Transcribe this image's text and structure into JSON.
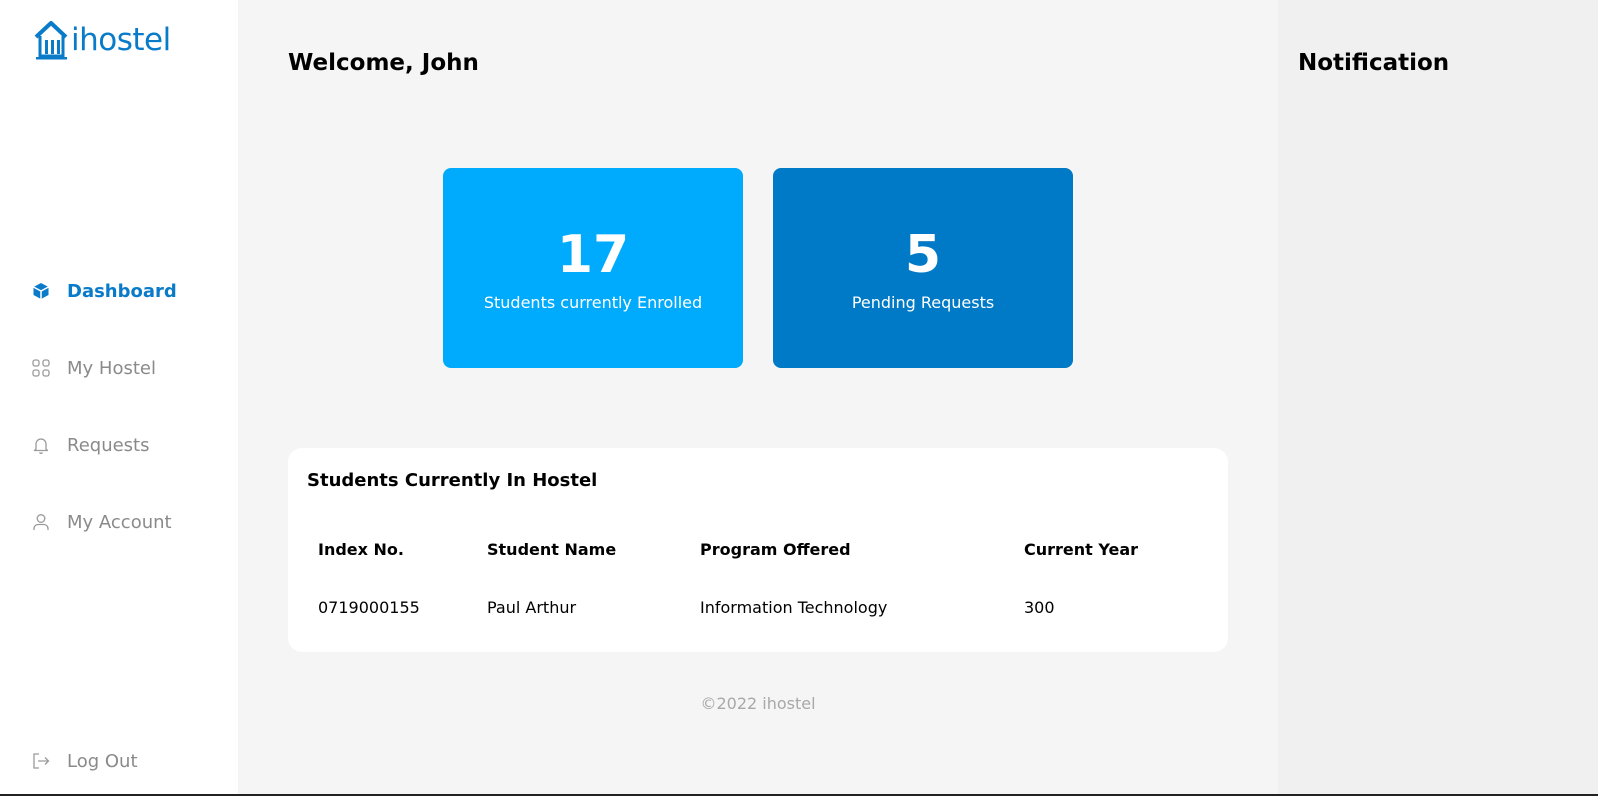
{
  "brand": {
    "name": "ihostel",
    "color": "#0a7bc9"
  },
  "sidebar": {
    "items": [
      {
        "label": "Dashboard",
        "icon": "cube-icon",
        "active": true
      },
      {
        "label": "My Hostel",
        "icon": "grid-icon",
        "active": false
      },
      {
        "label": "Requests",
        "icon": "bell-icon",
        "active": false
      },
      {
        "label": "My Account",
        "icon": "user-icon",
        "active": false
      }
    ],
    "logout": {
      "label": "Log Out",
      "icon": "logout-icon"
    }
  },
  "main": {
    "welcome": "Welcome, John",
    "stats": [
      {
        "value": "17",
        "label": "Students currently Enrolled",
        "color": "#00abfd"
      },
      {
        "value": "5",
        "label": "Pending Requests",
        "color": "#0079c6"
      }
    ],
    "table": {
      "title": "Students Currently In Hostel",
      "columns": [
        "Index No.",
        "Student Name",
        "Program Offered",
        "Current Year"
      ],
      "rows": [
        [
          "0719000155",
          "Paul Arthur",
          "Information Technology",
          "300"
        ]
      ]
    },
    "footer": "©2022 ihostel"
  },
  "notifications": {
    "title": "Notification"
  }
}
